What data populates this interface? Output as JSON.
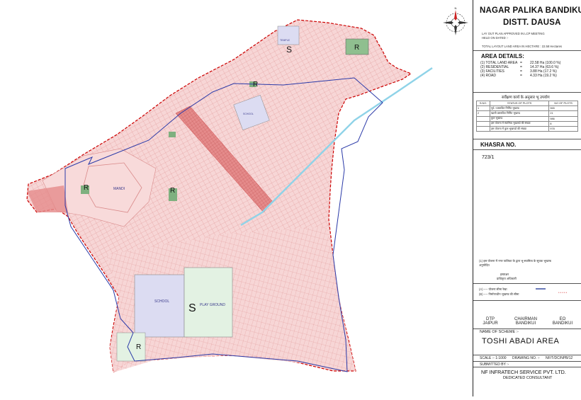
{
  "map": {
    "labels": {
      "mandi": "MANDI",
      "school_top": "SCHOOL",
      "school_main": "SCHOOL",
      "play_ground": "PLAY GROUND",
      "temple": "TEMPLE"
    },
    "zone_letters": {
      "s_top": "S",
      "r_top": "R",
      "r_mid": "R",
      "r_left": "R",
      "r_center": "R",
      "s_main": "S",
      "r_bottom": "R"
    },
    "compass": {
      "n": "N",
      "e": "E",
      "s": "S",
      "w": "W"
    },
    "colors": {
      "boundary": "#cc0000",
      "scheme_line": "#2b3aa8",
      "plots": "#f4c9c9",
      "road_band": "#e07070",
      "school": "#dcdcf2",
      "playground": "#dff0df",
      "canal": "#8fd3e8"
    }
  },
  "panel": {
    "title1": "NAGAR PALIKA BANDIKUI",
    "title2": "DISTT. DAUSA",
    "approval1": "LAY OUT PLAN APPROVED IN LCP MEETING",
    "approval2": "HELD ON DATED :-",
    "total_area_text": "TOTAL LAYOUT LAND AREA IN HECTARE : 22.58 Hectares",
    "area_details_title": "AREA DETAILS:",
    "area_rows": [
      {
        "label": "(1) TOTAL LAND AREA",
        "eq": "=",
        "value": "22.58 Ha (100.0 %)"
      },
      {
        "label": "(2) RESIDENTIAL",
        "eq": "=",
        "value": "14.37 Ha (63.6 %)"
      },
      {
        "label": "(3) FACILITIES",
        "eq": "=",
        "value": "3.88 Ha (17.2 %)"
      },
      {
        "label": "(4) ROAD",
        "eq": "=",
        "value": "4.33 Ha (19.2 %)"
      }
    ],
    "survey_title": "सर्वेक्षण कार्य के अनुसार भू उपयोग",
    "status_table": {
      "headers": [
        "S.NO.",
        "STATUS OF PLOTS",
        "NO OF PLOTS"
      ],
      "rows": [
        [
          "1",
          "पूर्व / प्रस्तावित निर्मित भूखण्ड",
          "965"
        ],
        [
          "2",
          "खाली प्रस्तावित निर्मित भूखण्ड",
          "21"
        ],
        [
          "",
          "कुल भूखण्ड",
          "986"
        ],
        [
          "",
          "इस योजना में स्वामित्व भूखण्डों की संख्या",
          "8"
        ],
        [
          "",
          "इस योजना में कुल भूखण्डों की संख्या",
          "978"
        ]
      ]
    },
    "khasra_title": "KHASRA NO.",
    "khasra_value": "723/1",
    "note_line": "(1) इस योजना में नगर पालिका के द्वारा भू-स्वामित्व के सूचक भूखण्ड",
    "note_line2": "अनुमोदित",
    "sig_small1": "हस्ताक्षर",
    "sig_small2": "प्राधिकृत अधिकारी",
    "legend1": "(A) ---- योजना सीमा रेखा",
    "legend2": "(B) ---- निर्माणाधीन भूखण्ड की सीमा",
    "signatories": [
      {
        "role": "DTP",
        "place": "JAIPUR"
      },
      {
        "role": "CHAIRMAN",
        "place": "BANDIKUI"
      },
      {
        "role": "EO",
        "place": "BANDIKUI"
      }
    ],
    "scheme_label": "NAME OF SCHEME :-",
    "scheme_name": "TOSHI ABADI AREA",
    "scale": "SCALE :- 1:1000",
    "drawing_label": "DRAWING NO. :-",
    "drawing_no": "NF/T/DC/NPB/12",
    "submitted_by": "SUBMITTED BY :-",
    "company": "NF INFRATECH SERVICE PVT. LTD.",
    "consultant": "DEDICATED CONSULTANT"
  }
}
